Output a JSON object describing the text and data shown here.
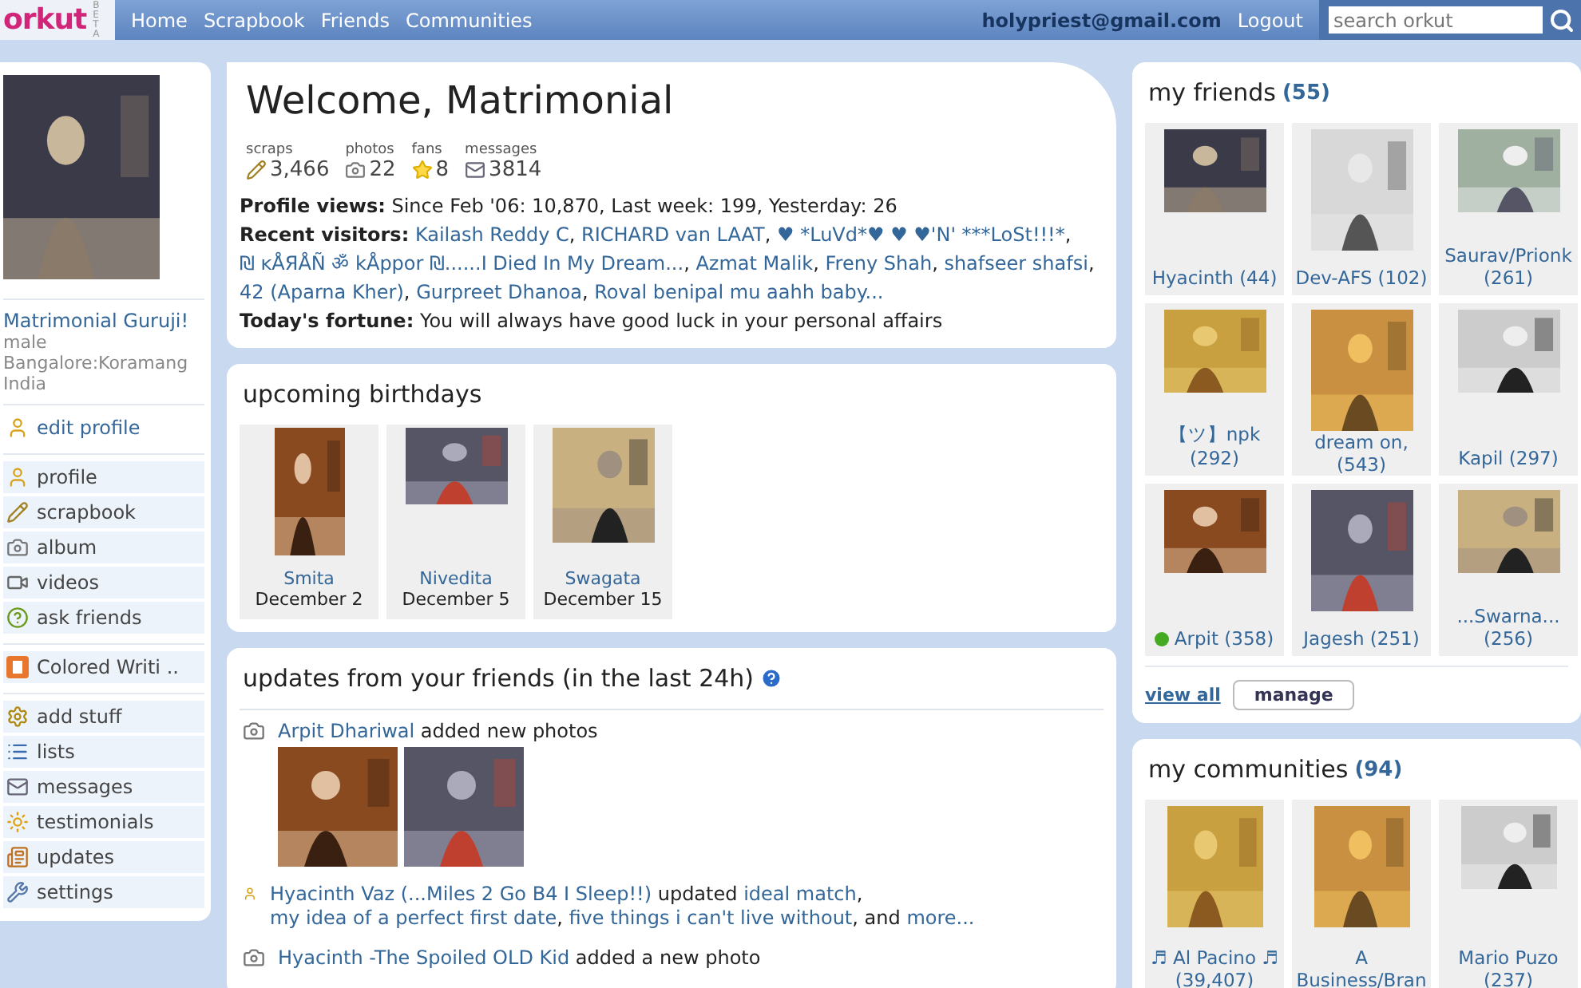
{
  "topbar": {
    "logo": "orkut",
    "beta": "BETA",
    "nav": [
      "Home",
      "Scrapbook",
      "Friends",
      "Communities"
    ],
    "email": "holypriest@gmail.com",
    "logout": "Logout",
    "search_placeholder": "search orkut"
  },
  "profile": {
    "name": "Matrimonial Guruji!",
    "details": [
      "male",
      "Bangalore:Koramang",
      "India"
    ]
  },
  "sidebar_groups": [
    [
      {
        "label": "edit profile"
      }
    ],
    [
      {
        "label": "profile"
      },
      {
        "label": "scrapbook"
      },
      {
        "label": "album"
      },
      {
        "label": "videos"
      },
      {
        "label": "ask friends"
      }
    ],
    [
      {
        "label": "Colored Writi .."
      }
    ],
    [
      {
        "label": "add stuff"
      },
      {
        "label": "lists"
      },
      {
        "label": "messages"
      },
      {
        "label": "testimonials"
      },
      {
        "label": "updates"
      },
      {
        "label": "settings"
      }
    ]
  ],
  "welcome": {
    "title": "Welcome, Matrimonial",
    "stats": [
      {
        "label": "scraps",
        "value": "3,466"
      },
      {
        "label": "photos",
        "value": "22"
      },
      {
        "label": "fans",
        "value": "8"
      },
      {
        "label": "messages",
        "value": "3814"
      }
    ],
    "separator": ",",
    "profile_views_label": "Profile views:",
    "profile_views": "Since Feb '06: 10,870, Last week: 199, Yesterday: 26",
    "visitors_label": "Recent visitors:",
    "visitors": [
      "Kailash Reddy C",
      "RICHARD van LAAT",
      "♥ *LuVd*♥ ♥ ♥'N' ***LoSt!!!*",
      "₪ ĸÅЯÅÑ ॐ kÅppor ₪......I Died In My Dream...",
      "Azmat Malik",
      "Freny Shah",
      "shafseer shafsi",
      "42 (Aparna Kher)",
      "Gurpreet Dhanoa",
      "Roval benipal mu aahh baby..."
    ],
    "fortune_label": "Today's fortune:",
    "fortune": "You will always have good luck in your personal affairs"
  },
  "birthdays": {
    "title": "upcoming birthdays",
    "items": [
      {
        "name": "Smita",
        "date": "December 2"
      },
      {
        "name": "Nivedita",
        "date": "December 5"
      },
      {
        "name": "Swagata",
        "date": "December 15"
      }
    ]
  },
  "updates": {
    "title": "updates from your friends (in the last 24h)",
    "items": [
      {
        "kind": "photos",
        "actor": "Arpit Dhariwal",
        "action": "added new photos"
      },
      {
        "kind": "profile",
        "actor": "Hyacinth Vaz (...Miles 2 Go B4 I Sleep!!)",
        "action": "updated",
        "links": [
          "ideal match",
          "my idea of a perfect first date",
          "five things i can't live without"
        ],
        "separator": ",",
        "and": "and",
        "more": "more..."
      },
      {
        "kind": "photos",
        "actor": "Hyacinth -The Spoiled OLD Kid",
        "action": "added a new photo"
      }
    ]
  },
  "friends": {
    "title": "my friends",
    "count": "(55)",
    "items": [
      {
        "name": "Hyacinth (44)",
        "online": false
      },
      {
        "name": "Dev-AFS (102)",
        "online": false
      },
      {
        "name": "Saurav/Prionk (261)",
        "online": false
      },
      {
        "name": "【ツ】npk (292)",
        "online": false
      },
      {
        "name": "dream on, (543)",
        "online": false
      },
      {
        "name": "Kapil (297)",
        "online": false
      },
      {
        "name": "Arpit (358)",
        "online": true
      },
      {
        "name": "Jagesh (251)",
        "online": false
      },
      {
        "name": "...Swarna... (256)",
        "online": false
      }
    ],
    "view_all": "view all",
    "manage": "manage"
  },
  "communities": {
    "title": "my communities",
    "count": "(94)",
    "items": [
      {
        "name": "♬ Al Pacino ♬ (39,407)"
      },
      {
        "name": "A Business/Bran"
      },
      {
        "name": "Mario Puzo (237)"
      }
    ]
  }
}
